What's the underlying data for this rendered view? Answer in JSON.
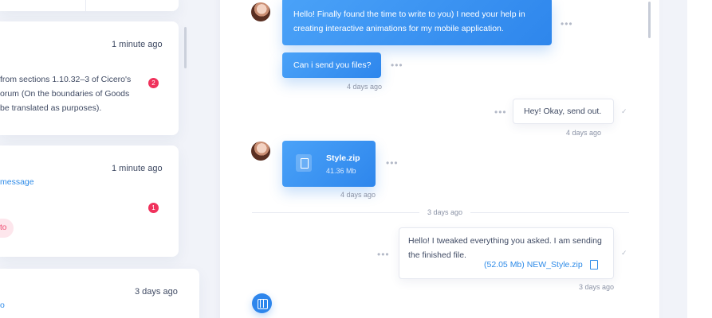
{
  "conversation_list": [
    {
      "time": "1 minute ago",
      "snippet_lines": [
        "from sections 1.10.32–3 of Cicero's",
        "orum (On the boundaries of Goods",
        "be translated as purposes)."
      ],
      "unread_count": "2"
    },
    {
      "time": "1 minute ago",
      "link_text": "message",
      "unread_count": "1",
      "tag": "to"
    },
    {
      "time": "3 days ago",
      "link_text": "o"
    }
  ],
  "chat": {
    "messages": [
      {
        "lines": [
          "Hello! Finally found the time to write to you) I need your help in",
          "creating interactive animations for my mobile application."
        ]
      },
      {
        "lines": [
          "Can i send you files?"
        ],
        "time": "4 days ago"
      },
      {
        "lines": [
          "Hey! Okay, send out."
        ],
        "time": "4 days ago"
      },
      {
        "file_name": "Style.zip",
        "file_size": "41.36 Mb",
        "time": "4 days ago"
      },
      {
        "lines": [
          "Hello! I tweaked everything you asked. I am sending",
          "the finished file."
        ],
        "attachment": "(52.05 Mb) NEW_Style.zip",
        "time": "3 days ago"
      }
    ],
    "separator": "3 days ago"
  },
  "icons": {
    "more": "more-dots-icon",
    "read": "check-icon",
    "file": "file-icon",
    "document": "document-icon",
    "film": "film-icon"
  },
  "colors": {
    "accent": "#2e86ec",
    "badge": "#f0325c",
    "tag_bg": "#fde6ec",
    "tag_text": "#ee4a6f",
    "background": "#f1f3f9"
  }
}
